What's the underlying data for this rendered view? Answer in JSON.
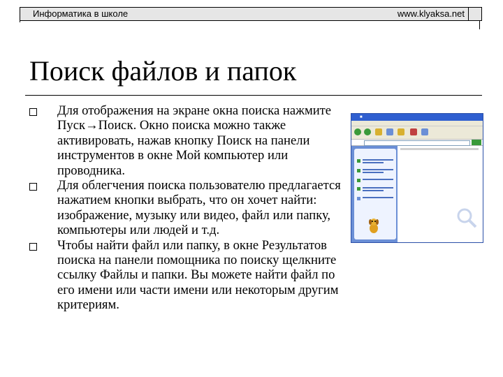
{
  "header": {
    "left_text": "Информатика в школе",
    "right_text": "www.klyaksa.net"
  },
  "slide": {
    "title": "Поиск файлов и папок",
    "bullets": [
      "Для отображения на экране окна поиска нажмите Пуск→Поиск. Окно поиска можно также активировать, нажав кнопку Поиск на панели инструментов в окне Мой компьютер или проводника.",
      "Для облегчения поиска пользователю предлагается нажатием кнопки выбрать, что он хочет найти: изображение, музыку или видео, файл или папку, компьютеры или людей и т.д.",
      "Чтобы найти файл или папку, в окне Результатов поиска на панели помощника по поиску щелкните ссылку Файлы и папки. Вы можете найти файл по его имени или части имени или некоторым другим критериям."
    ]
  },
  "colors": {
    "title_bar": "#2f5fd0",
    "side_pane": "#6b8fd6",
    "panel_bg": "#eef3ff",
    "go_button": "#3a9a3a"
  }
}
